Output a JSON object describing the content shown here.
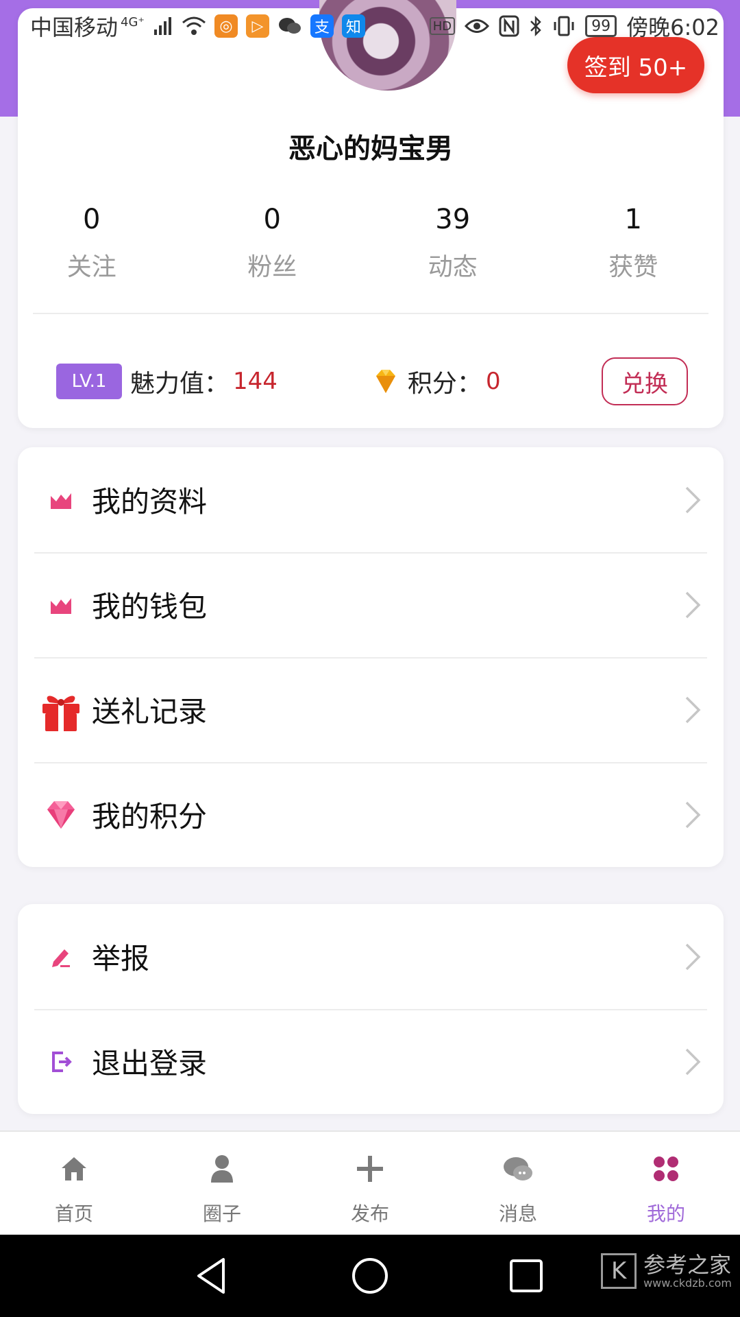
{
  "status_bar": {
    "carrier": "中国移动",
    "network": "4G⁺",
    "battery": "99",
    "time": "傍晚6:02"
  },
  "profile": {
    "checkin_label": "签到 50+",
    "username": "恶心的妈宝男",
    "stats": [
      {
        "value": "0",
        "label": "关注"
      },
      {
        "value": "0",
        "label": "粉丝"
      },
      {
        "value": "39",
        "label": "动态"
      },
      {
        "value": "1",
        "label": "获赞"
      }
    ],
    "level_badge": "LV.1",
    "charm_label": "魅力值：",
    "charm_value": "144",
    "points_label": "积分：",
    "points_value": "0",
    "exchange_label": "兑换"
  },
  "menu_main": [
    {
      "label": "我的资料",
      "icon": "chart-icon"
    },
    {
      "label": "我的钱包",
      "icon": "chart-icon"
    },
    {
      "label": "送礼记录",
      "icon": "gift-icon"
    },
    {
      "label": "我的积分",
      "icon": "diamond-icon"
    }
  ],
  "menu_secondary": [
    {
      "label": "举报",
      "icon": "edit-icon"
    },
    {
      "label": "退出登录",
      "icon": "logout-icon"
    }
  ],
  "bottom_nav": [
    {
      "label": "首页",
      "icon": "home-icon"
    },
    {
      "label": "圈子",
      "icon": "user-icon"
    },
    {
      "label": "发布",
      "icon": "plus-icon"
    },
    {
      "label": "消息",
      "icon": "chat-icon"
    },
    {
      "label": "我的",
      "icon": "grid-icon",
      "active": true
    }
  ],
  "watermark": {
    "title": "参考之家",
    "url": "www.ckdzb.com",
    "mark": "K"
  },
  "colors": {
    "accent_purple": "#a56ee6",
    "checkin_red": "#e53228",
    "value_red": "#c7262e",
    "menu_pink": "#e8457d",
    "active_nav": "#a06ad9"
  }
}
